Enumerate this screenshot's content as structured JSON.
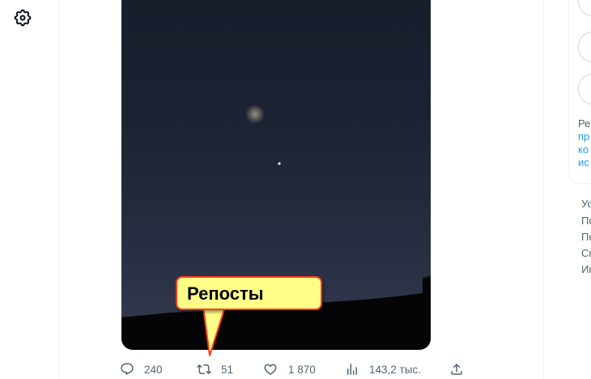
{
  "icons": {
    "settings": "gear-icon",
    "reply": "reply-icon",
    "repost": "repost-icon",
    "like": "heart-icon",
    "views": "bar-chart-icon",
    "share": "share-icon"
  },
  "post": {
    "stats": {
      "replies": "240",
      "reposts": "51",
      "likes": "1 870",
      "views": "143,2 тыс."
    }
  },
  "callout": {
    "text": "Репосты",
    "fill": "#ffff88",
    "border": "#ff3b1f"
  },
  "sidebar": {
    "card_lines": [
      "Реп",
      "пр",
      "ко",
      "ис"
    ],
    "footer_links": [
      "Ус",
      "По",
      "По",
      "Сп",
      "Ин"
    ]
  },
  "colors": {
    "muted": "#536471",
    "link": "#1d9bf0",
    "divider": "#eff3f4"
  }
}
